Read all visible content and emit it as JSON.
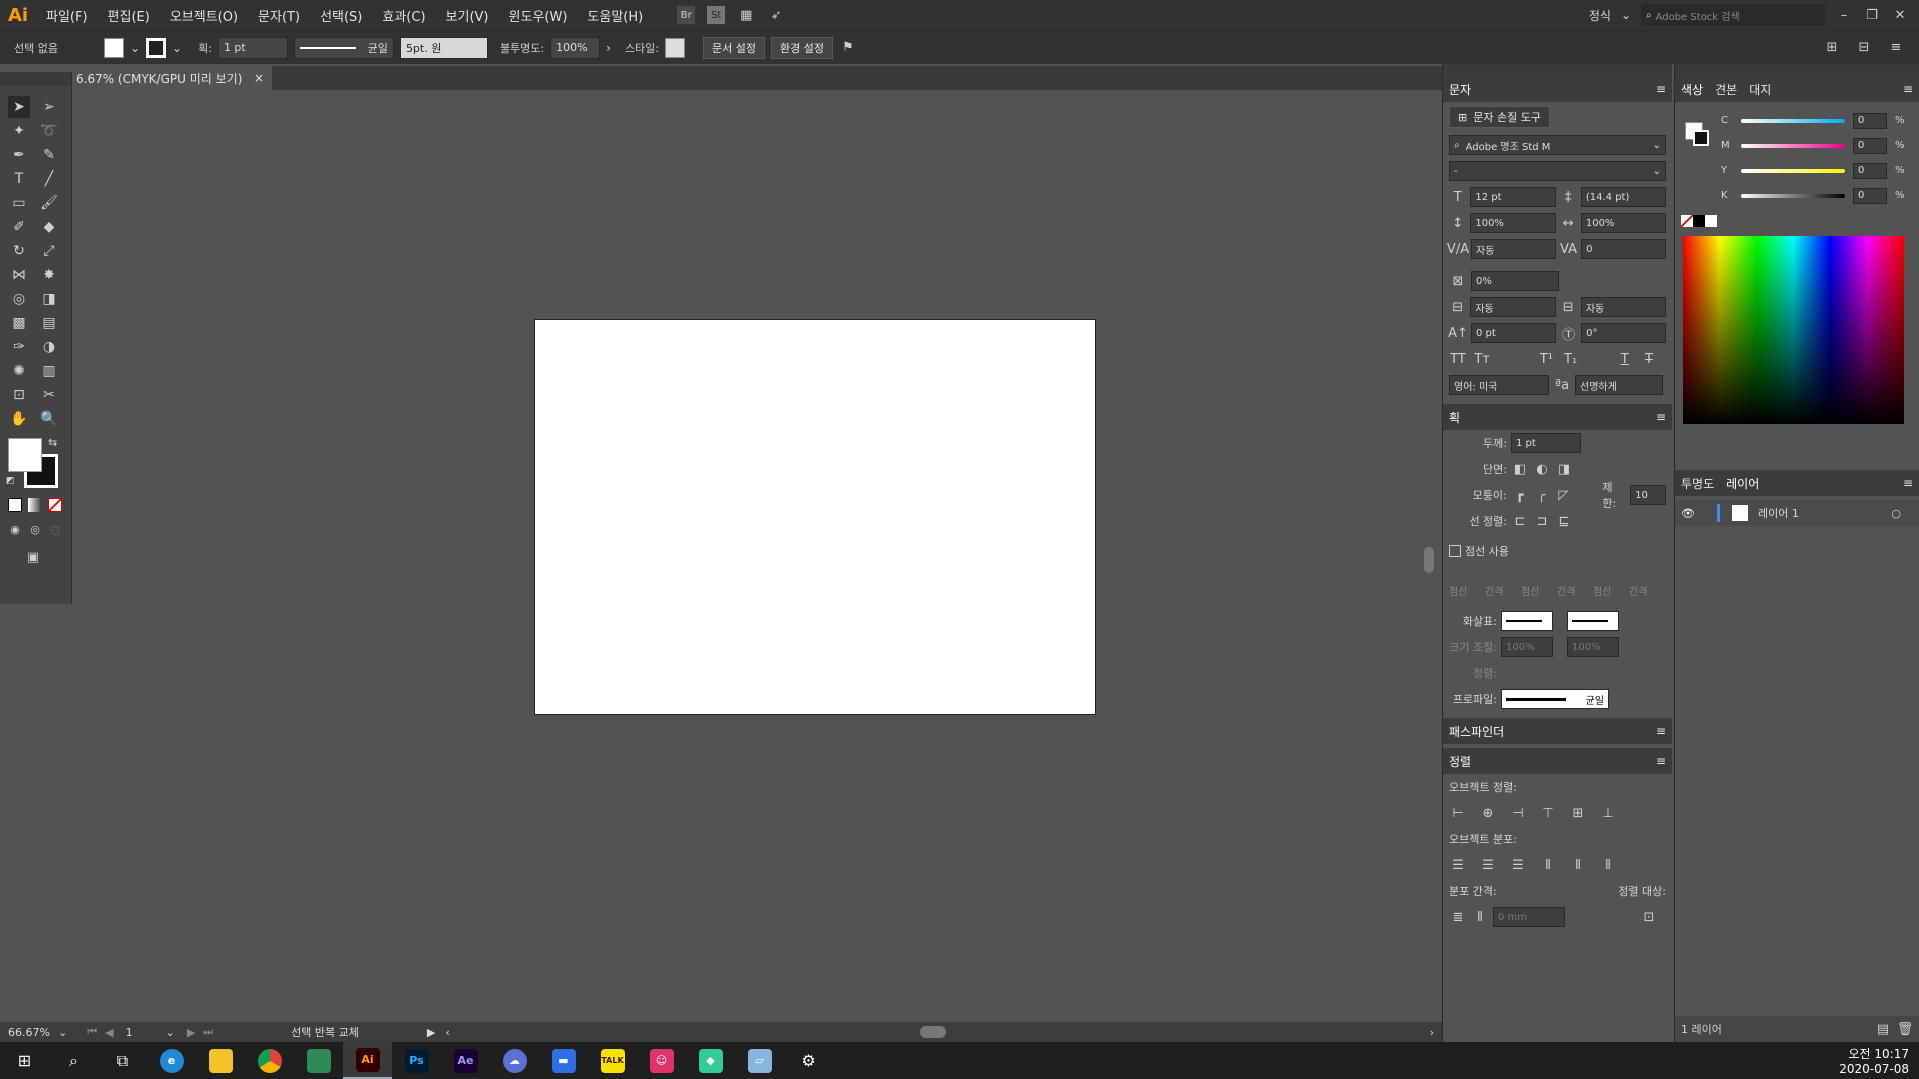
{
  "app": {
    "logo": "Ai"
  },
  "menu": [
    "파일(F)",
    "편집(E)",
    "오브젝트(O)",
    "문자(T)",
    "선택(S)",
    "효과(C)",
    "보기(V)",
    "윈도우(W)",
    "도움말(H)"
  ],
  "menu_right": {
    "workspace": "정식",
    "search_placeholder": "Adobe Stock 검색"
  },
  "control": {
    "selection": "선택 없음",
    "stroke_label": "획:",
    "stroke_value": "1 pt",
    "stroke_style": "균일",
    "brush": "5pt. 원",
    "opacity_label": "불투명도:",
    "opacity_value": "100%",
    "style_label": "스타일:",
    "doc_setup": "문서 설정",
    "prefs": "환경 설정"
  },
  "document": {
    "tab_title": "6.67% (CMYK/GPU 미리 보기)",
    "close": "×"
  },
  "status": {
    "zoom": "66.67%",
    "artboard": "1",
    "tool": "선택 반복 교체"
  },
  "character": {
    "title": "문자",
    "touch_tool": "문자 손질 도구",
    "font": "Adobe 명조 Std M",
    "style": "-",
    "size": "12 pt",
    "leading": "(14.4 pt)",
    "vscale": "100%",
    "hscale": "100%",
    "kerning": "자동",
    "tracking": "0",
    "tsume": "0%",
    "aki_left": "자동",
    "aki_right": "자동",
    "baseline": "0 pt",
    "rotate": "0°",
    "language": "영어: 미국",
    "antialias": "선명하게"
  },
  "stroke": {
    "title": "획",
    "weight_label": "두께:",
    "weight": "1 pt",
    "cap_label": "단면:",
    "corner_label": "모퉁이:",
    "limit_label": "제한:",
    "limit": "10",
    "align_label": "선 정렬:",
    "dashed_label": "점선 사용",
    "dash_labels": [
      "점선",
      "간격",
      "점선",
      "간격",
      "점선",
      "간격"
    ],
    "arrow_label": "화살표:",
    "scale_label": "크기 조절:",
    "scale1": "100%",
    "scale2": "100%",
    "align2_label": "정렬:",
    "profile_label": "프로파일:",
    "profile": "균일"
  },
  "pathfinder": {
    "title": "패스파인더"
  },
  "align": {
    "title": "정렬",
    "object_align": "오브젝트 정렬:",
    "object_dist": "오브젝트 분포:",
    "dist_spacing": "분포 간격:",
    "align_to": "정렬 대상:",
    "spacing_value": "0 mm"
  },
  "color": {
    "tabs": [
      "색상",
      "견본",
      "대지"
    ],
    "channels": [
      {
        "label": "C",
        "value": "0",
        "unit": "%",
        "color": "#00aeef"
      },
      {
        "label": "M",
        "value": "0",
        "unit": "%",
        "color": "#ec008c"
      },
      {
        "label": "Y",
        "value": "0",
        "unit": "%",
        "color": "#fff200"
      },
      {
        "label": "K",
        "value": "0",
        "unit": "%",
        "color": "#000000"
      }
    ]
  },
  "layers": {
    "tabs": [
      "투명도",
      "레이어"
    ],
    "items": [
      {
        "name": "레이어 1"
      }
    ],
    "footer": "1 레이어"
  },
  "taskbar": {
    "time": "오전 10:17",
    "date": "2020-07-08"
  }
}
